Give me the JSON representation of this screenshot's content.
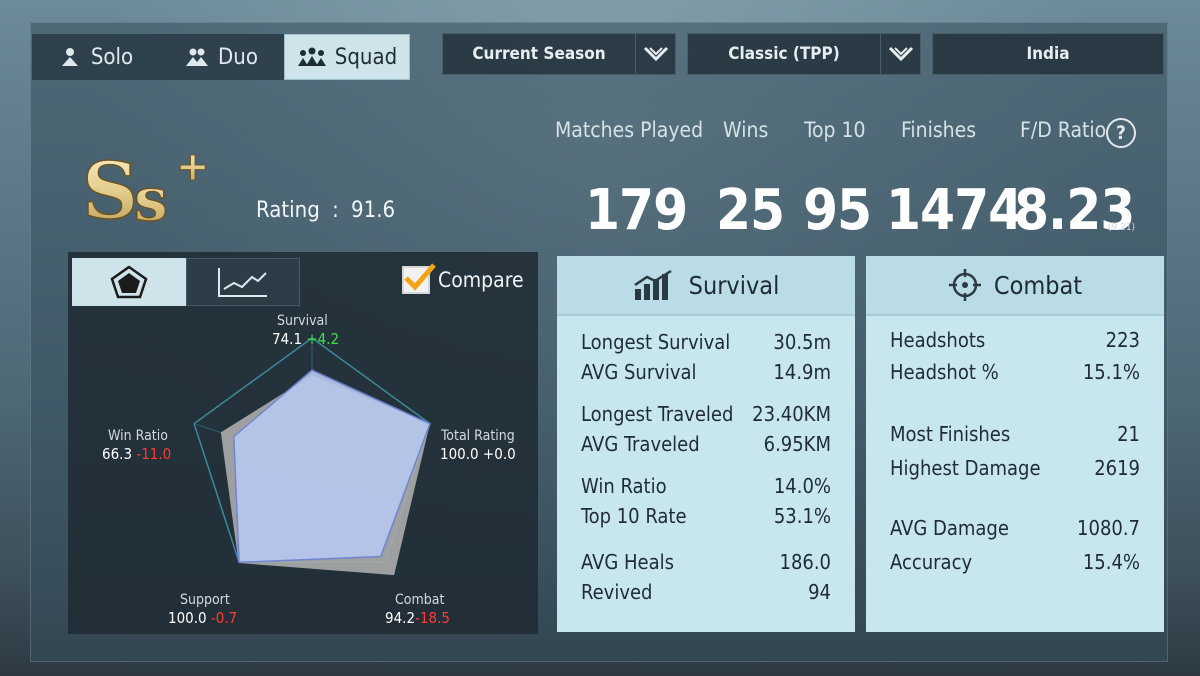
{
  "mode_tabs": [
    {
      "label": "Solo",
      "active": false
    },
    {
      "label": "Duo",
      "active": false
    },
    {
      "label": "Squad",
      "active": true
    }
  ],
  "filters": {
    "season": "Current Season",
    "mode": "Classic (TPP)",
    "region": "India"
  },
  "rating": {
    "tier_text": "Ss+",
    "label": "Rating",
    "separator": ":",
    "value": "91.6"
  },
  "stats": {
    "matches_played": {
      "label": "Matches Played",
      "value": "179"
    },
    "wins": {
      "label": "Wins",
      "value": "25"
    },
    "top10": {
      "label": "Top 10",
      "value": "95"
    },
    "finishes": {
      "label": "Finishes",
      "value": "1474"
    },
    "fd_ratio": {
      "label": "F/D Ratio",
      "value": "8.23",
      "sub": "(9.21)"
    }
  },
  "chart_controls": {
    "compare_label": "Compare",
    "compare_checked": true
  },
  "chart_data": {
    "type": "radar",
    "axes": [
      "Survival",
      "Total Rating",
      "Combat",
      "Support",
      "Win Ratio"
    ],
    "max": 100,
    "series": [
      {
        "values": [
          74.1,
          100.0,
          94.2,
          100.0,
          66.3
        ],
        "color": "#b7c8ef"
      },
      {
        "values": [
          69.9,
          100.0,
          112.7,
          100.7,
          77.3
        ],
        "color": "#a9a9a9"
      }
    ],
    "labels": {
      "survival": {
        "name": "Survival",
        "value": "74.1",
        "delta": "+4.2",
        "delta_color": "#3fe04a"
      },
      "total_rating": {
        "name": "Total Rating",
        "value": "100.0",
        "delta": "+0.0",
        "delta_color": "#ffffff"
      },
      "combat": {
        "name": "Combat",
        "value": "94.2",
        "delta": "-18.5",
        "delta_color": "#ff3a30"
      },
      "support": {
        "name": "Support",
        "value": "100.0",
        "delta": "-0.7",
        "delta_color": "#ff3a30"
      },
      "win_ratio": {
        "name": "Win Ratio",
        "value": "66.3",
        "delta": "-11.0",
        "delta_color": "#ff3a30"
      }
    }
  },
  "survival_card": {
    "title": "Survival",
    "icon": "bar-chart-icon",
    "rows": [
      {
        "label": "Longest Survival",
        "value": "30.5m"
      },
      {
        "label": "AVG Survival",
        "value": "14.9m"
      },
      {
        "label": "Longest Traveled",
        "value": "23.40KM"
      },
      {
        "label": "AVG Traveled",
        "value": "6.95KM"
      },
      {
        "label": "Win Ratio",
        "value": "14.0%"
      },
      {
        "label": "Top 10 Rate",
        "value": "53.1%"
      },
      {
        "label": "AVG Heals",
        "value": "186.0"
      },
      {
        "label": "Revived",
        "value": "94"
      }
    ]
  },
  "combat_card": {
    "title": "Combat",
    "icon": "crosshair-icon",
    "rows": [
      {
        "label": "Headshots",
        "value": "223"
      },
      {
        "label": "Headshot %",
        "value": "15.1%"
      },
      {
        "label": "Most Finishes",
        "value": "21"
      },
      {
        "label": "Highest Damage",
        "value": "2619"
      },
      {
        "label": "AVG Damage",
        "value": "1080.7"
      },
      {
        "label": "Accuracy",
        "value": "15.4%"
      }
    ]
  },
  "colors": {
    "accent_panel": "#c7e6ee",
    "positive": "#3fe04a",
    "negative": "#ff3a30",
    "rank_gold": "#e8d59a"
  }
}
